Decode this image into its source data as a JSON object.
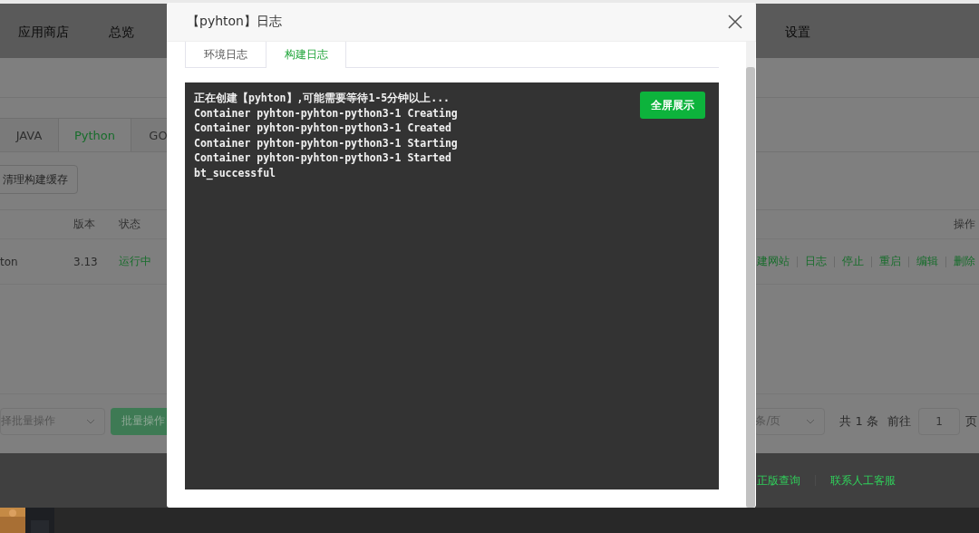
{
  "nav": {
    "items": [
      {
        "label": "应用商店"
      },
      {
        "label": "总览"
      }
    ],
    "right_item": {
      "label": "设置"
    }
  },
  "runtime_tabs": [
    {
      "label": "JAVA",
      "selected": false
    },
    {
      "label": "Python",
      "selected": true
    },
    {
      "label": "GO",
      "selected": false
    }
  ],
  "clear_cache_button": "清理构建缓存",
  "table": {
    "columns": [
      {
        "label": "版本"
      },
      {
        "label": "状态"
      }
    ],
    "actions_column": "操作",
    "rows": [
      {
        "name": "ton",
        "version": "3.13",
        "status": "运行中",
        "running": true,
        "actions": [
          "建网站",
          "日志",
          "停止",
          "重启",
          "编辑",
          "删除"
        ]
      }
    ]
  },
  "batch": {
    "select_placeholder": "择批量操作",
    "button": "批量操作"
  },
  "pagination": {
    "page_size": "条/页",
    "total": "共 1 条",
    "goto": "前往",
    "page": "1",
    "page_unit": "页"
  },
  "footer_links": [
    "正版查询",
    "联系人工客服"
  ],
  "dialog": {
    "title": "【pyhton】日志",
    "tabs": [
      {
        "label": "环境日志",
        "selected": false
      },
      {
        "label": "构建日志",
        "selected": true
      }
    ],
    "log_lines": [
      "正在创建【pyhton】,可能需要等待1-5分钟以上...",
      "Container pyhton-pyhton-python3-1 Creating",
      "Container pyhton-pyhton-python3-1 Created",
      "Container pyhton-pyhton-python3-1 Starting",
      "Container pyhton-pyhton-python3-1 Started",
      "bt_successful"
    ],
    "fullscreen_button": "全屏展示"
  }
}
